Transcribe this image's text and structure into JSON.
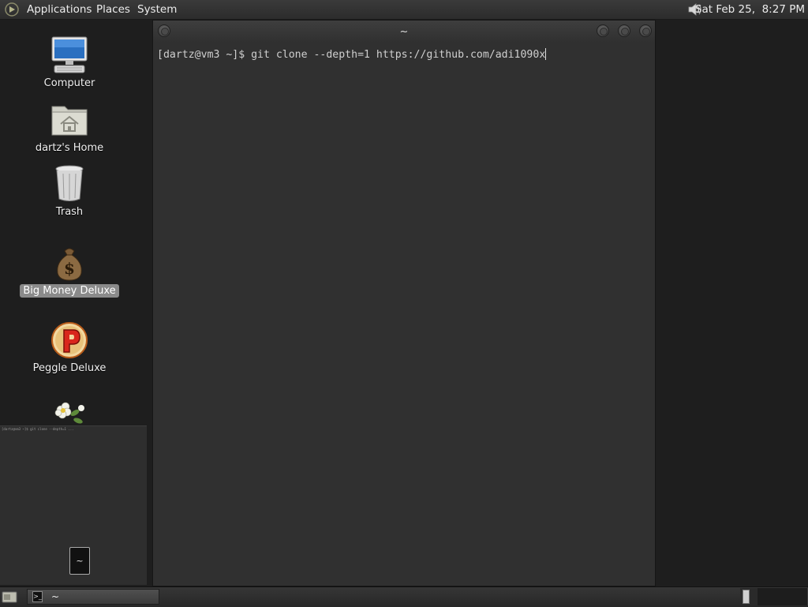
{
  "top_panel": {
    "menus": [
      "Applications",
      "Places",
      "System"
    ],
    "clock": "Sat Feb 25,  8:27 PM"
  },
  "desktop": {
    "icons": [
      {
        "label": "Computer",
        "icon": "computer-icon"
      },
      {
        "label": "dartz's Home",
        "icon": "home-folder-icon"
      },
      {
        "label": "Trash",
        "icon": "trash-icon"
      },
      {
        "label": "Big Money Deluxe",
        "icon": "money-bag-icon",
        "selected": true
      },
      {
        "label": "Peggle Deluxe",
        "icon": "peggle-icon"
      },
      {
        "label": "",
        "icon": "flowers-icon"
      }
    ]
  },
  "terminal": {
    "title": "~",
    "prompt": "[dartz@vm3 ~]$ ",
    "command": "git clone --depth=1 https://github.com/adi1090x"
  },
  "workspace_preview": {
    "mini_text": "[dartz@vm3 ~]$ git clone --depth=1 ...",
    "mini_window_label": "~"
  },
  "bottom_panel": {
    "task_label": "~"
  },
  "colors": {
    "panel": "#2c2c2c",
    "desktop": "#1e1e1e",
    "terminal_bg": "#303030",
    "selection": "#8a8a8a"
  }
}
